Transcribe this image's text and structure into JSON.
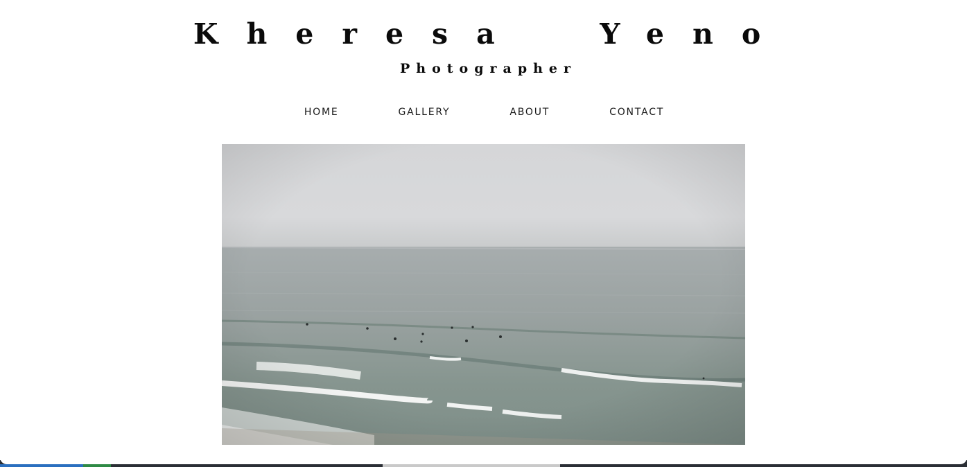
{
  "site": {
    "title": "Kheresa  Yeno",
    "subtitle": "Photographer"
  },
  "nav": {
    "items": [
      {
        "label": "HOME"
      },
      {
        "label": "GALLERY"
      },
      {
        "label": "ABOUT"
      },
      {
        "label": "CONTACT"
      }
    ]
  },
  "hero": {
    "image_subject": "overcast-ocean-surfers-photo"
  },
  "colors": {
    "text": "#0a0a0a",
    "background": "#ffffff",
    "sky": "#d7d8da",
    "sea": "#8b9996",
    "foam": "#f2f3f2"
  }
}
